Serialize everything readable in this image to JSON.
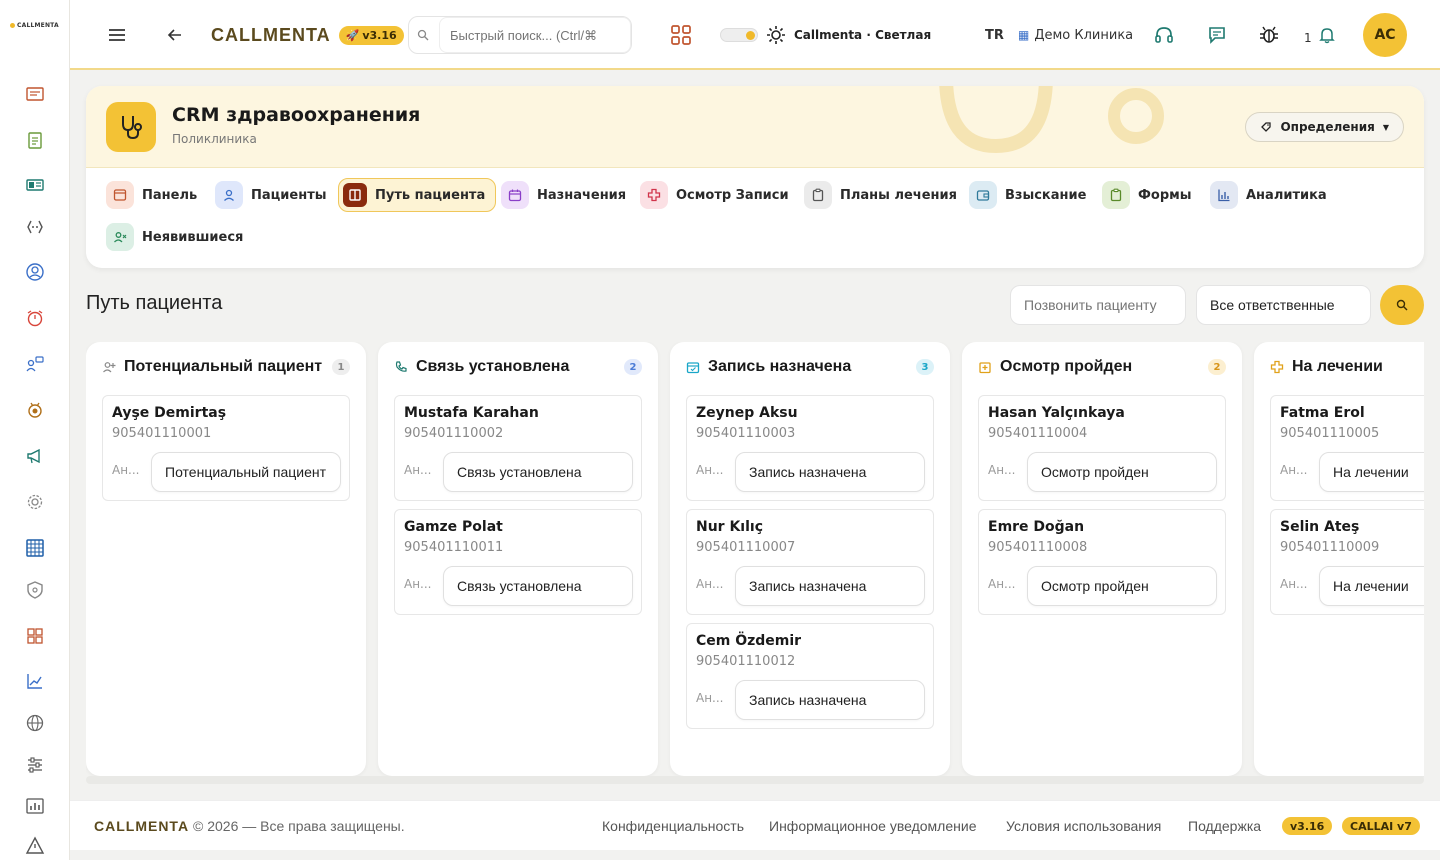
{
  "rail": {
    "logo": "CALLMENTA"
  },
  "topbar": {
    "brand": "CALLMENTA",
    "version": "v3.16",
    "search_placeholder": "Быстрый поиск... (Ctrl/⌘",
    "theme_label": "Callmenta · Светлая",
    "lang": "TR",
    "clinic": "Демо Клиника",
    "notifications_count": "1",
    "avatar": "AC"
  },
  "module": {
    "title": "CRM здравоохранения",
    "subtitle": "Поликлиника",
    "definitions_label": "Определения",
    "tabs": [
      {
        "label": "Панель"
      },
      {
        "label": "Пациенты"
      },
      {
        "label": "Путь пациента"
      },
      {
        "label": "Назначения"
      },
      {
        "label": "Осмотр Записи"
      },
      {
        "label": "Планы лечения"
      },
      {
        "label": "Взыскание"
      },
      {
        "label": "Формы"
      },
      {
        "label": "Аналитика"
      },
      {
        "label": "Неявившиеся"
      }
    ]
  },
  "section": {
    "title": "Путь пациента",
    "call_placeholder": "Позвонить пациенту",
    "owner_filter": "Все ответственные"
  },
  "board": {
    "columns": [
      {
        "title": "Потенциальный пациент",
        "count": "1",
        "color": "#8a8a8a",
        "cards": [
          {
            "name": "Ayşe Demirtaş",
            "phone": "905401110001",
            "owner": "Ан...",
            "stage": "Потенциальный пациент"
          }
        ]
      },
      {
        "title": "Связь установлена",
        "count": "2",
        "color": "#4a7bd6",
        "cards": [
          {
            "name": "Mustafa Karahan",
            "phone": "905401110002",
            "owner": "Ан...",
            "stage": "Связь установлена"
          },
          {
            "name": "Gamze Polat",
            "phone": "905401110011",
            "owner": "Ан...",
            "stage": "Связь установлена"
          }
        ]
      },
      {
        "title": "Запись назначена",
        "count": "3",
        "color": "#1aa6c8",
        "cards": [
          {
            "name": "Zeynep Aksu",
            "phone": "905401110003",
            "owner": "Ан...",
            "stage": "Запись назначена"
          },
          {
            "name": "Nur Kılıç",
            "phone": "905401110007",
            "owner": "Ан...",
            "stage": "Запись назначена"
          },
          {
            "name": "Cem Özdemir",
            "phone": "905401110012",
            "owner": "Ан...",
            "stage": "Запись назначена"
          }
        ]
      },
      {
        "title": "Осмотр пройден",
        "count": "2",
        "color": "#e0a11a",
        "cards": [
          {
            "name": "Hasan Yalçınkaya",
            "phone": "905401110004",
            "owner": "Ан...",
            "stage": "Осмотр пройден"
          },
          {
            "name": "Emre Doğan",
            "phone": "905401110008",
            "owner": "Ан...",
            "stage": "Осмотр пройден"
          }
        ]
      },
      {
        "title": "На лечении",
        "count": "",
        "color": "#e0a11a",
        "cards": [
          {
            "name": "Fatma Erol",
            "phone": "905401110005",
            "owner": "Ан...",
            "stage": "На лечении"
          },
          {
            "name": "Selin Ateş",
            "phone": "905401110009",
            "owner": "Ан...",
            "stage": "На лечении"
          }
        ]
      }
    ]
  },
  "footer": {
    "brand": "CALLMENTA",
    "copyright": "© 2026 — Все права защищены.",
    "links": [
      "Конфиденциальность",
      "Информационное уведомление",
      "Условия использования",
      "Поддержка"
    ],
    "version": "v3.16",
    "ai_version": "CALLAI v7"
  }
}
